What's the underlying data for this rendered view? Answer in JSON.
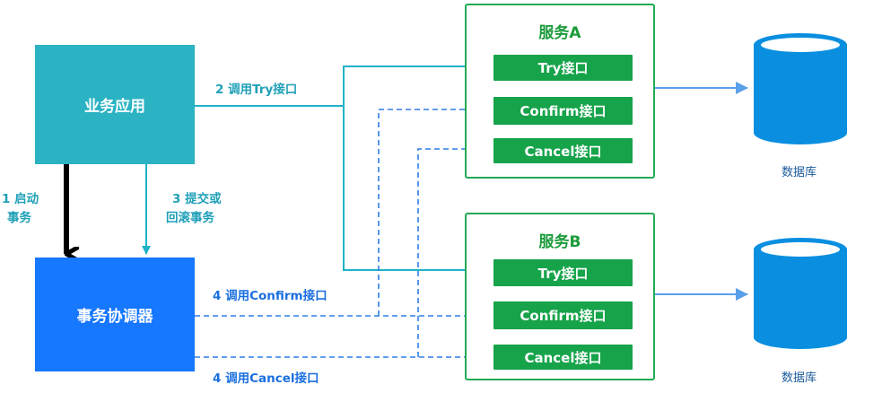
{
  "nodes": {
    "business_app": "业务应用",
    "coordinator": "事务协调器",
    "service_a": {
      "title": "服务A",
      "try": "Try接口",
      "confirm": "Confirm接口",
      "cancel": "Cancel接口"
    },
    "service_b": {
      "title": "服务B",
      "try": "Try接口",
      "confirm": "Confirm接口",
      "cancel": "Cancel接口"
    },
    "db_a": "数据库",
    "db_b": "数据库"
  },
  "edges": {
    "start_tx_line1": "1 启动",
    "start_tx_line2": "事务",
    "call_try": "2 调用Try接口",
    "commit_line1": "3 提交或",
    "commit_line2": "回滚事务",
    "call_confirm": "4 调用Confirm接口",
    "call_cancel": "4 调用Cancel接口"
  },
  "colors": {
    "teal": "#2bb3c4",
    "blue": "#1677ff",
    "green": "#16a34a",
    "db": "#0a8fe0"
  }
}
